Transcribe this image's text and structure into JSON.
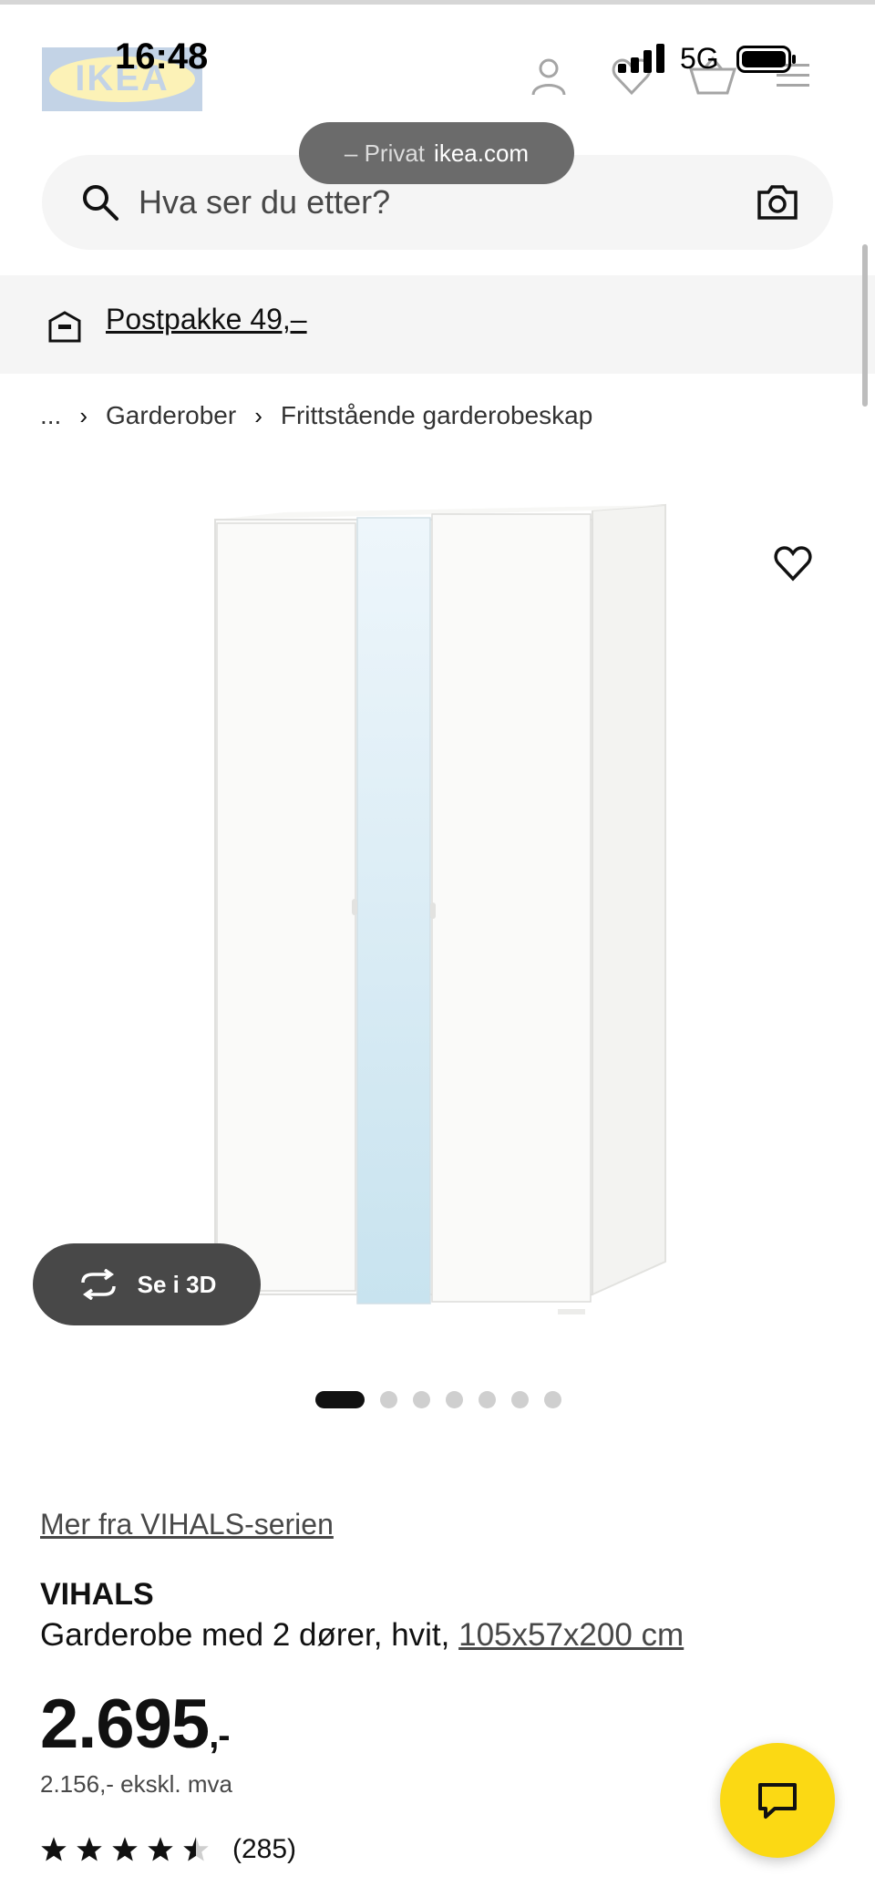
{
  "status_bar": {
    "time": "16:48",
    "network": "5G"
  },
  "header": {
    "logo_text": "IKEA"
  },
  "private_pill": {
    "prefix": "– Privat",
    "domain": "ikea.com"
  },
  "search": {
    "placeholder": "Hva ser du etter?"
  },
  "banner": {
    "label": "Postpakke 49,–"
  },
  "breadcrumb": {
    "items": [
      "...",
      "Garderober",
      "Frittstående garderobeskap"
    ]
  },
  "gallery": {
    "view_3d_label": "Se i 3D",
    "image_count": 7,
    "active_index": 0
  },
  "product": {
    "series_link": "Mer fra VIHALS-serien",
    "name": "VIHALS",
    "description": "Garderobe med 2 dører, hvit, ",
    "dimensions": "105x57x200 cm",
    "price_main": "2.695",
    "price_suffix": ",-",
    "price_excl_vat": "2.156,- ekskl. mva",
    "rating_value": 4.5,
    "rating_count": "(285)"
  },
  "colors": {
    "brand_yellow": "#fbd914",
    "brand_blue": "#0058a3",
    "dark_button": "#484848"
  }
}
